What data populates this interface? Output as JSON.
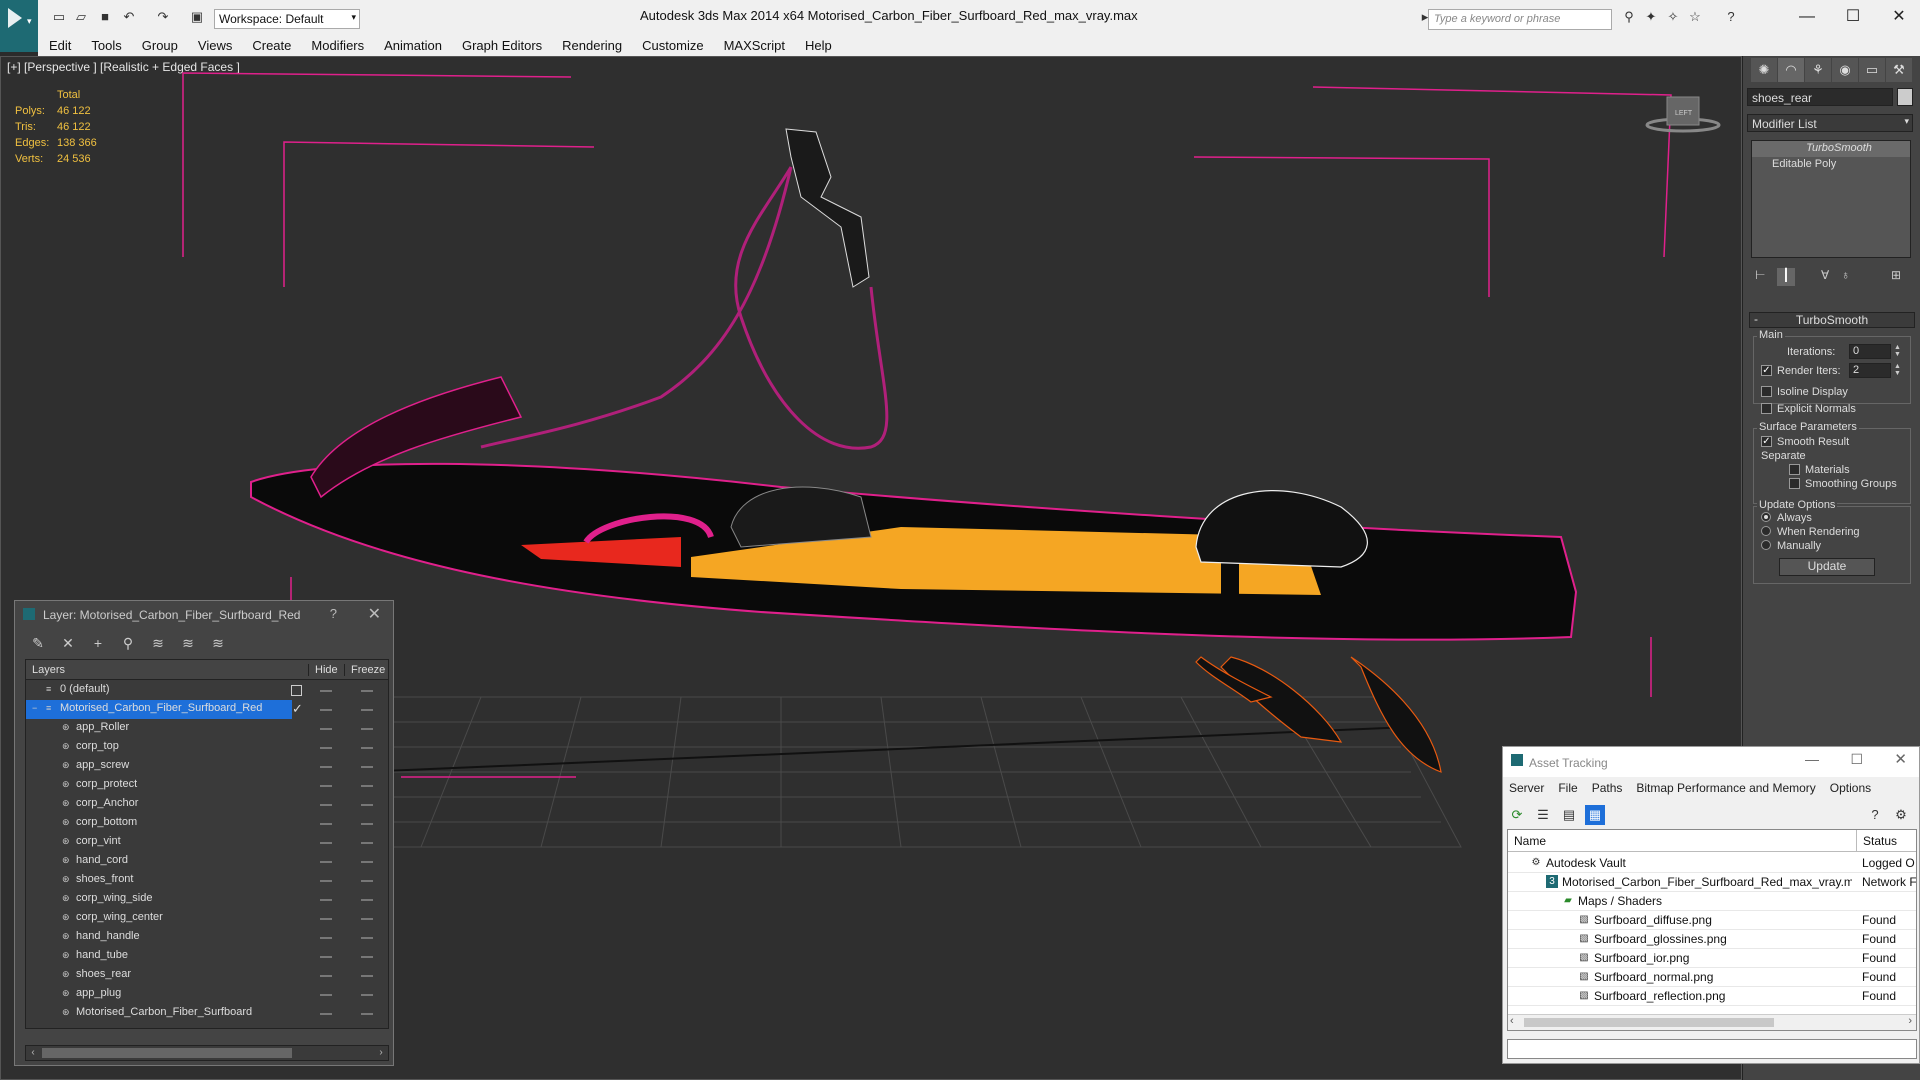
{
  "app": {
    "title": "Autodesk 3ds Max  2014 x64     Motorised_Carbon_Fiber_Surfboard_Red_max_vray.max",
    "workspace": "Workspace: Default",
    "search_placeholder": "Type a keyword or phrase",
    "menu": [
      "Edit",
      "Tools",
      "Group",
      "Views",
      "Create",
      "Modifiers",
      "Animation",
      "Graph Editors",
      "Rendering",
      "Customize",
      "MAXScript",
      "Help"
    ]
  },
  "viewport": {
    "label": "[+] [Perspective ] [Realistic + Edged Faces ]",
    "stats": {
      "header": "Total",
      "rows": [
        {
          "k": "Polys:",
          "v": "46 122"
        },
        {
          "k": "Tris:",
          "v": "46 122"
        },
        {
          "k": "Edges:",
          "v": "138 366"
        },
        {
          "k": "Verts:",
          "v": "24 536"
        }
      ]
    },
    "viewcube_label": "LEFT"
  },
  "command_panel": {
    "object_name": "shoes_rear",
    "modifier_list": "Modifier List",
    "stack": [
      "TurboSmooth",
      "Editable Poly"
    ],
    "rollout_title": "TurboSmooth",
    "main_group": "Main",
    "iterations_label": "Iterations:",
    "iterations_value": "0",
    "render_iters_label": "Render Iters:",
    "render_iters_value": "2",
    "isoline_label": "Isoline Display",
    "explicit_normals_label": "Explicit Normals",
    "surface_params_group": "Surface Parameters",
    "smooth_result_label": "Smooth Result",
    "separate_label": "Separate",
    "materials_label": "Materials",
    "smoothing_groups_label": "Smoothing Groups",
    "update_options_group": "Update Options",
    "always_label": "Always",
    "when_rendering_label": "When Rendering",
    "manually_label": "Manually",
    "update_button": "Update"
  },
  "layer_dialog": {
    "title": "Layer: Motorised_Carbon_Fiber_Surfboard_Red",
    "help": "?",
    "col_layers": "Layers",
    "col_hide": "Hide",
    "col_freeze": "Freeze",
    "rows": [
      {
        "name": "0 (default)",
        "level": 0
      },
      {
        "name": "Motorised_Carbon_Fiber_Surfboard_Red",
        "level": 0
      },
      {
        "name": "app_Roller",
        "level": 1
      },
      {
        "name": "corp_top",
        "level": 1
      },
      {
        "name": "app_screw",
        "level": 1
      },
      {
        "name": "corp_protect",
        "level": 1
      },
      {
        "name": "corp_Anchor",
        "level": 1
      },
      {
        "name": "corp_bottom",
        "level": 1
      },
      {
        "name": "corp_vint",
        "level": 1
      },
      {
        "name": "hand_cord",
        "level": 1
      },
      {
        "name": "shoes_front",
        "level": 1
      },
      {
        "name": "corp_wing_side",
        "level": 1
      },
      {
        "name": "corp_wing_center",
        "level": 1
      },
      {
        "name": "hand_handle",
        "level": 1
      },
      {
        "name": "hand_tube",
        "level": 1
      },
      {
        "name": "shoes_rear",
        "level": 1
      },
      {
        "name": "app_plug",
        "level": 1
      },
      {
        "name": "Motorised_Carbon_Fiber_Surfboard",
        "level": 1
      }
    ]
  },
  "asset_tracking": {
    "title": "Asset Tracking",
    "menu": [
      "Server",
      "File",
      "Paths",
      "Bitmap Performance and Memory",
      "Options"
    ],
    "col_name": "Name",
    "col_status": "Status",
    "rows": [
      {
        "name": "Autodesk Vault",
        "status": "Logged O",
        "indent": 0
      },
      {
        "name": "Motorised_Carbon_Fiber_Surfboard_Red_max_vray.max",
        "status": "Network F",
        "indent": 1
      },
      {
        "name": "Maps / Shaders",
        "status": "",
        "indent": 2
      },
      {
        "name": "Surfboard_diffuse.png",
        "status": "Found",
        "indent": 3
      },
      {
        "name": "Surfboard_glossines.png",
        "status": "Found",
        "indent": 3
      },
      {
        "name": "Surfboard_ior.png",
        "status": "Found",
        "indent": 3
      },
      {
        "name": "Surfboard_normal.png",
        "status": "Found",
        "indent": 3
      },
      {
        "name": "Surfboard_reflection.png",
        "status": "Found",
        "indent": 3
      }
    ]
  },
  "colors": {
    "wire": "#e0208c",
    "board_orange": "#f5a623",
    "board_red": "#e8281e",
    "selection": "#1e6fd9",
    "stats": "#f0c040"
  }
}
